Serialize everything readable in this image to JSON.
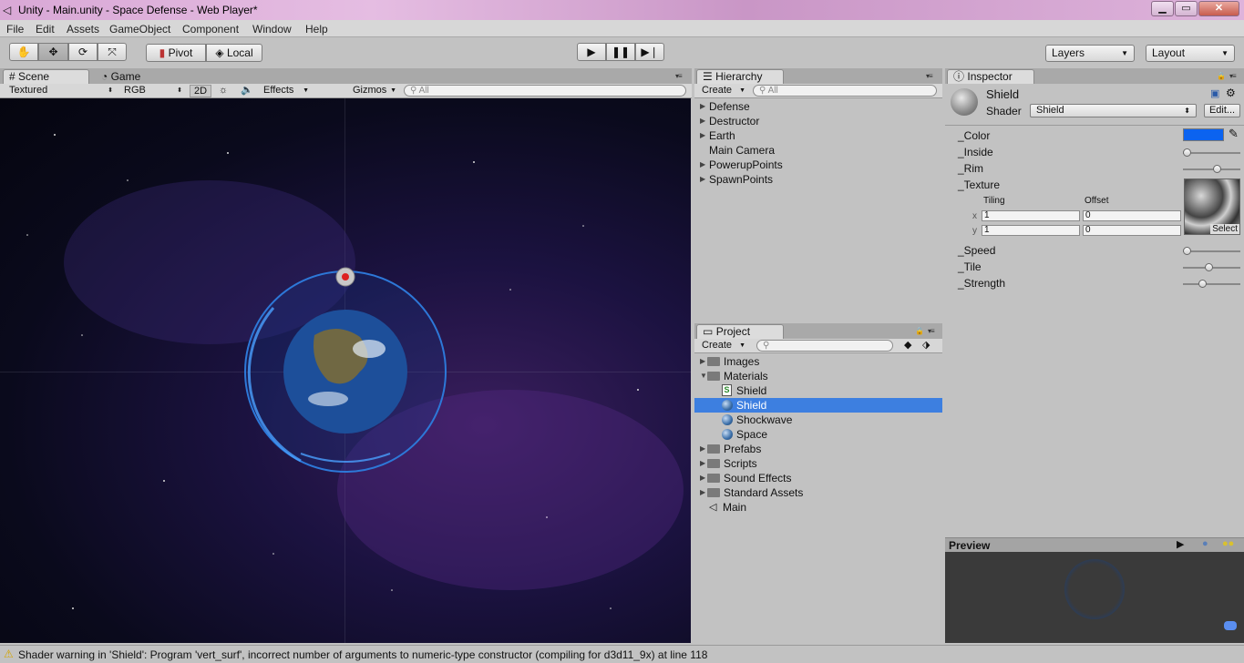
{
  "window": {
    "title": "Unity - Main.unity - Space Defense - Web Player*",
    "minimize": "▁",
    "maximize": "▭",
    "close": "✕"
  },
  "menu": [
    "File",
    "Edit",
    "Assets",
    "GameObject",
    "Component",
    "Window",
    "Help"
  ],
  "toolbar": {
    "pivot": "Pivot",
    "local": "Local",
    "layers": "Layers",
    "layout": "Layout"
  },
  "scene_panel": {
    "tabs": [
      "Scene",
      "Game"
    ],
    "shading": "Textured",
    "render_mode": "RGB",
    "mode_2d": "2D",
    "effects": "Effects",
    "gizmos": "Gizmos",
    "search_placeholder": "All"
  },
  "hierarchy": {
    "title": "Hierarchy",
    "create": "Create",
    "search_placeholder": "All",
    "items": [
      {
        "label": "Defense",
        "expandable": true
      },
      {
        "label": "Destructor",
        "expandable": true
      },
      {
        "label": "Earth",
        "expandable": true
      },
      {
        "label": "Main Camera",
        "expandable": false
      },
      {
        "label": "PowerupPoints",
        "expandable": true
      },
      {
        "label": "SpawnPoints",
        "expandable": true
      }
    ]
  },
  "project": {
    "title": "Project",
    "create": "Create",
    "items": [
      {
        "label": "Images",
        "type": "folder",
        "expanded": false
      },
      {
        "label": "Materials",
        "type": "folder",
        "expanded": true
      },
      {
        "label": "Shield",
        "type": "shader"
      },
      {
        "label": "Shield",
        "type": "material",
        "selected": true
      },
      {
        "label": "Shockwave",
        "type": "material"
      },
      {
        "label": "Space",
        "type": "material"
      },
      {
        "label": "Prefabs",
        "type": "folder",
        "expanded": false
      },
      {
        "label": "Scripts",
        "type": "folder",
        "expanded": false
      },
      {
        "label": "Sound Effects",
        "type": "folder",
        "expanded": false
      },
      {
        "label": "Standard Assets",
        "type": "folder",
        "expanded": false
      },
      {
        "label": "Main",
        "type": "scene"
      }
    ]
  },
  "inspector": {
    "title": "Inspector",
    "material_name": "Shield",
    "shader_label": "Shader",
    "shader_value": "Shield",
    "edit_button": "Edit...",
    "props": {
      "color": "_Color",
      "inside": "_Inside",
      "rim": "_Rim",
      "texture": "_Texture",
      "tiling": "Tiling",
      "offset": "Offset",
      "x": "x",
      "y": "y",
      "tiling_x": "1",
      "tiling_y": "1",
      "offset_x": "0",
      "offset_y": "0",
      "select": "Select",
      "speed": "_Speed",
      "tile": "_Tile",
      "strength": "_Strength"
    },
    "slider_values": {
      "inside": 0.0,
      "rim": 0.6,
      "speed": 0.0,
      "tile": 0.45,
      "strength": 0.33
    },
    "color_value": "#0b63f0",
    "preview_label": "Preview"
  },
  "status": {
    "message": "Shader warning in 'Shield': Program 'vert_surf', incorrect number of arguments to numeric-type constructor (compiling for d3d11_9x) at line 118"
  }
}
